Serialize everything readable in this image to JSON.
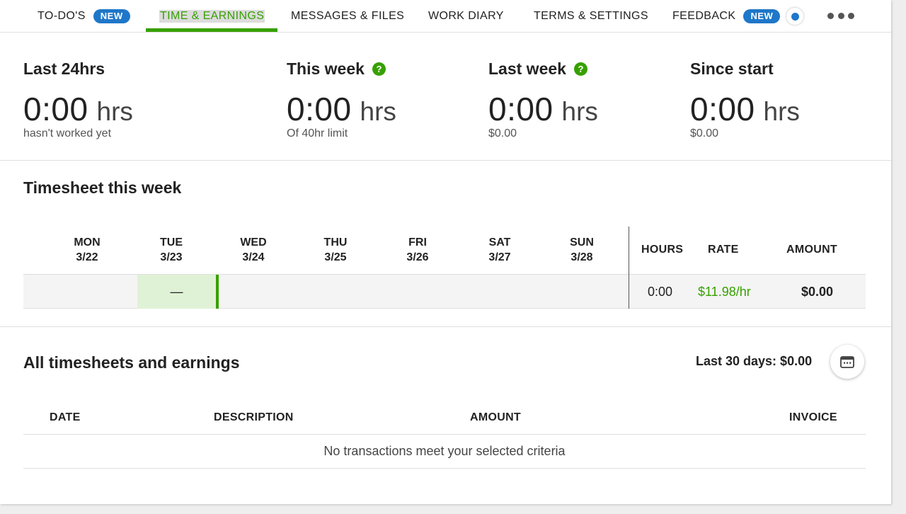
{
  "nav": {
    "items": [
      {
        "label": "TO-DO'S",
        "badge": "NEW"
      },
      {
        "label": "TIME & EARNINGS"
      },
      {
        "label": "MESSAGES & FILES"
      },
      {
        "label": "WORK DIARY"
      },
      {
        "label": "TERMS & SETTINGS"
      },
      {
        "label": "FEEDBACK",
        "badge": "NEW"
      }
    ],
    "active_index": 1,
    "more_icon": "ellipsis-icon",
    "notification_dot_color": "#1f77c9"
  },
  "stats": [
    {
      "title": "Last 24hrs",
      "value": "0:00",
      "unit": "hrs",
      "sub": "hasn't worked yet"
    },
    {
      "title": "This week",
      "help": "?",
      "value": "0:00",
      "unit": "hrs",
      "sub": "Of 40hr limit"
    },
    {
      "title": "Last week",
      "help": "?",
      "value": "0:00",
      "unit": "hrs",
      "sub": "$0.00"
    },
    {
      "title": "Since start",
      "value": "0:00",
      "unit": "hrs",
      "sub": "$0.00"
    }
  ],
  "timesheet": {
    "title": "Timesheet this week",
    "days": [
      {
        "name": "MON",
        "date": "3/22"
      },
      {
        "name": "TUE",
        "date": "3/23"
      },
      {
        "name": "WED",
        "date": "3/24"
      },
      {
        "name": "THU",
        "date": "3/25"
      },
      {
        "name": "FRI",
        "date": "3/26"
      },
      {
        "name": "SAT",
        "date": "3/27"
      },
      {
        "name": "SUN",
        "date": "3/28"
      }
    ],
    "cols": {
      "hours": "HOURS",
      "rate": "RATE",
      "amount": "AMOUNT"
    },
    "row": {
      "tue": "—",
      "hours": "0:00",
      "rate": "$11.98/hr",
      "amount": "$0.00"
    }
  },
  "all_timesheets": {
    "title": "All timesheets and earnings",
    "last30": "Last 30 days: $0.00",
    "calendar_icon": "calendar-icon",
    "cols": {
      "date": "DATE",
      "description": "DESCRIPTION",
      "amount": "AMOUNT",
      "invoice": "INVOICE"
    },
    "empty": "No transactions meet your selected criteria"
  },
  "colors": {
    "accent_green": "#37a000",
    "badge_blue": "#1f77c9",
    "today_cell": "#e0f2d6"
  }
}
